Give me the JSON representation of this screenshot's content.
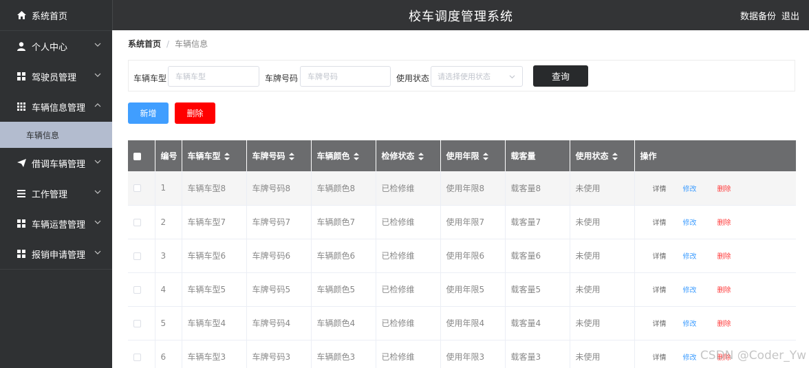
{
  "app": {
    "title": "校车调度管理系统"
  },
  "header": {
    "backup_label": "数据备份",
    "logout_label": "退出"
  },
  "sidebar": {
    "items": [
      {
        "label": "系统首页",
        "icon": "home-icon"
      },
      {
        "label": "个人中心",
        "icon": "user-icon",
        "expanded": false
      },
      {
        "label": "驾驶员管理",
        "icon": "grid-icon",
        "expanded": false
      },
      {
        "label": "车辆信息管理",
        "icon": "grid9-icon",
        "expanded": true
      },
      {
        "label": "借调车辆管理",
        "icon": "send-icon",
        "expanded": false
      },
      {
        "label": "工作管理",
        "icon": "list-icon",
        "expanded": false
      },
      {
        "label": "车辆运营管理",
        "icon": "grid-icon",
        "expanded": false
      },
      {
        "label": "报销申请管理",
        "icon": "grid-icon",
        "expanded": false
      }
    ],
    "sub_active": "车辆信息"
  },
  "breadcrumb": {
    "home": "系统首页",
    "separator": "/",
    "current": "车辆信息"
  },
  "search": {
    "type_label": "车辆车型",
    "type_placeholder": "车辆车型",
    "plate_label": "车牌号码",
    "plate_placeholder": "车牌号码",
    "status_label": "使用状态",
    "status_placeholder": "请选择使用状态",
    "query_button": "查询"
  },
  "actions": {
    "add_button": "新增",
    "delete_button": "删除"
  },
  "table": {
    "headers": {
      "no": "编号",
      "type": "车辆车型",
      "plate": "车牌号码",
      "color": "车辆颜色",
      "inspect": "检修状态",
      "years": "使用年限",
      "capacity": "载客量",
      "status": "使用状态",
      "ops": "操作"
    },
    "row_actions": {
      "detail": "详情",
      "edit": "修改",
      "delete": "删除"
    },
    "rows": [
      {
        "no": "1",
        "type": "车辆车型8",
        "plate": "车牌号码8",
        "color": "车辆颜色8",
        "inspect": "已检修维",
        "years": "使用年限8",
        "capacity": "载客量8",
        "status": "未使用"
      },
      {
        "no": "2",
        "type": "车辆车型7",
        "plate": "车牌号码7",
        "color": "车辆颜色7",
        "inspect": "已检修维",
        "years": "使用年限7",
        "capacity": "载客量7",
        "status": "未使用"
      },
      {
        "no": "3",
        "type": "车辆车型6",
        "plate": "车牌号码6",
        "color": "车辆颜色6",
        "inspect": "已检修维",
        "years": "使用年限6",
        "capacity": "载客量6",
        "status": "未使用"
      },
      {
        "no": "4",
        "type": "车辆车型5",
        "plate": "车牌号码5",
        "color": "车辆颜色5",
        "inspect": "已检修维",
        "years": "使用年限5",
        "capacity": "载客量5",
        "status": "未使用"
      },
      {
        "no": "5",
        "type": "车辆车型4",
        "plate": "车牌号码4",
        "color": "车辆颜色4",
        "inspect": "已检修维",
        "years": "使用年限4",
        "capacity": "载客量4",
        "status": "未使用"
      },
      {
        "no": "6",
        "type": "车辆车型3",
        "plate": "车牌号码3",
        "color": "车辆颜色3",
        "inspect": "已检修维",
        "years": "使用年限3",
        "capacity": "载客量3",
        "status": "未使用"
      }
    ]
  },
  "watermark": "CSDN @Coder_Yw",
  "colors": {
    "sidebar_bg": "#2f3133",
    "header_bg": "#333436",
    "active_sub_bg": "#b3bccf",
    "table_head_bg": "#6b6c6e",
    "primary": "#409eff",
    "danger": "#ff0000"
  }
}
